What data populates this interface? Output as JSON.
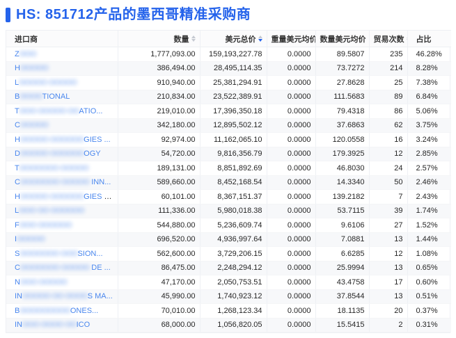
{
  "title": {
    "text": "HS: 851712产品的墨西哥精准采购商"
  },
  "colors": {
    "accent": "#2563eb",
    "link": "#4a87ee",
    "zebra": "#f7f8fa"
  },
  "table": {
    "columns": [
      {
        "label": "进口商",
        "align": "left",
        "sortable": false,
        "sort": null
      },
      {
        "label": "数量",
        "align": "right",
        "sortable": true,
        "sort": "none"
      },
      {
        "label": "美元总价",
        "align": "right",
        "sortable": true,
        "sort": "desc"
      },
      {
        "label": "重量美元均价",
        "align": "right",
        "sortable": false,
        "sort": null
      },
      {
        "label": "数量美元均价",
        "align": "right",
        "sortable": false,
        "sort": null
      },
      {
        "label": "贸易次数",
        "align": "right",
        "sortable": true,
        "sort": "none"
      },
      {
        "label": "占比",
        "align": "left",
        "sortable": false,
        "sort": null
      }
    ],
    "rows": [
      {
        "importer_parts": [
          {
            "text": "Z",
            "redacted": false
          },
          {
            "text": "OOO",
            "redacted": true
          }
        ],
        "quantity": "1,777,093.00",
        "usd_total": "159,193,227.78",
        "weight_unit_price": "0.0000",
        "qty_unit_price": "89.5807",
        "trade_count": "235",
        "share": "46.28%"
      },
      {
        "importer_parts": [
          {
            "text": "H",
            "redacted": false
          },
          {
            "text": "OOOOO",
            "redacted": true
          }
        ],
        "quantity": "386,494.00",
        "usd_total": "28,495,114.35",
        "weight_unit_price": "0.0000",
        "qty_unit_price": "73.7272",
        "trade_count": "214",
        "share": "8.28%"
      },
      {
        "importer_parts": [
          {
            "text": "L",
            "redacted": false
          },
          {
            "text": "OOOOO OOOOO",
            "redacted": true
          }
        ],
        "quantity": "910,940.00",
        "usd_total": "25,381,294.91",
        "weight_unit_price": "0.0000",
        "qty_unit_price": "27.8628",
        "trade_count": "25",
        "share": "7.38%"
      },
      {
        "importer_parts": [
          {
            "text": "B",
            "redacted": false
          },
          {
            "text": "OOOO",
            "redacted": true
          },
          {
            "text": "TIONAL",
            "redacted": false
          }
        ],
        "quantity": "210,834.00",
        "usd_total": "23,522,389.91",
        "weight_unit_price": "0.0000",
        "qty_unit_price": "111.5683",
        "trade_count": "89",
        "share": "6.84%"
      },
      {
        "importer_parts": [
          {
            "text": "T",
            "redacted": false
          },
          {
            "text": "OOO OOOOO OO",
            "redacted": true
          },
          {
            "text": "ATIO...",
            "redacted": false
          }
        ],
        "quantity": "219,010.00",
        "usd_total": "17,396,350.18",
        "weight_unit_price": "0.0000",
        "qty_unit_price": "79.4318",
        "trade_count": "86",
        "share": "5.06%"
      },
      {
        "importer_parts": [
          {
            "text": "C",
            "redacted": false
          },
          {
            "text": "OOOOO",
            "redacted": true
          }
        ],
        "quantity": "342,180.00",
        "usd_total": "12,895,502.12",
        "weight_unit_price": "0.0000",
        "qty_unit_price": "37.6863",
        "trade_count": "62",
        "share": "3.75%"
      },
      {
        "importer_parts": [
          {
            "text": "H",
            "redacted": false
          },
          {
            "text": "OOOOO OOOOOO",
            "redacted": true
          },
          {
            "text": "GIES ...",
            "redacted": false
          }
        ],
        "quantity": "92,974.00",
        "usd_total": "11,162,065.10",
        "weight_unit_price": "0.0000",
        "qty_unit_price": "120.0558",
        "trade_count": "16",
        "share": "3.24%"
      },
      {
        "importer_parts": [
          {
            "text": "D",
            "redacted": false
          },
          {
            "text": "OOOOO OOOOOO",
            "redacted": true
          },
          {
            "text": "OGY",
            "redacted": false
          }
        ],
        "quantity": "54,720.00",
        "usd_total": "9,816,356.79",
        "weight_unit_price": "0.0000",
        "qty_unit_price": "179.3925",
        "trade_count": "12",
        "share": "2.85%"
      },
      {
        "importer_parts": [
          {
            "text": "T",
            "redacted": false
          },
          {
            "text": "OOOOOOO OOOOO",
            "redacted": true
          }
        ],
        "quantity": "189,131.00",
        "usd_total": "8,851,892.69",
        "weight_unit_price": "0.0000",
        "qty_unit_price": "46.8030",
        "trade_count": "24",
        "share": "2.57%"
      },
      {
        "importer_parts": [
          {
            "text": "C",
            "redacted": false
          },
          {
            "text": "OOOOOOO OOOOO",
            "redacted": true
          },
          {
            "text": " INN...",
            "redacted": false
          }
        ],
        "quantity": "589,660.00",
        "usd_total": "8,452,168.54",
        "weight_unit_price": "0.0000",
        "qty_unit_price": "14.3340",
        "trade_count": "50",
        "share": "2.46%"
      },
      {
        "importer_parts": [
          {
            "text": "H",
            "redacted": false
          },
          {
            "text": "OOOOO OOOOOO",
            "redacted": true
          },
          {
            "text": "GIES D...",
            "redacted": false
          }
        ],
        "quantity": "60,101.00",
        "usd_total": "8,367,151.37",
        "weight_unit_price": "0.0000",
        "qty_unit_price": "139.2182",
        "trade_count": "7",
        "share": "2.43%"
      },
      {
        "importer_parts": [
          {
            "text": "L",
            "redacted": false
          },
          {
            "text": "OOO OO OOOOOO",
            "redacted": true
          }
        ],
        "quantity": "111,336.00",
        "usd_total": "5,980,018.38",
        "weight_unit_price": "0.0000",
        "qty_unit_price": "53.7115",
        "trade_count": "39",
        "share": "1.74%"
      },
      {
        "importer_parts": [
          {
            "text": "F",
            "redacted": false
          },
          {
            "text": "OOO OOOOOO",
            "redacted": true
          }
        ],
        "quantity": "544,880.00",
        "usd_total": "5,236,609.74",
        "weight_unit_price": "0.0000",
        "qty_unit_price": "9.6106",
        "trade_count": "27",
        "share": "1.52%"
      },
      {
        "importer_parts": [
          {
            "text": "I",
            "redacted": false
          },
          {
            "text": "OOOOO",
            "redacted": true
          }
        ],
        "quantity": "696,520.00",
        "usd_total": "4,936,997.64",
        "weight_unit_price": "0.0000",
        "qty_unit_price": "7.0881",
        "trade_count": "13",
        "share": "1.44%"
      },
      {
        "importer_parts": [
          {
            "text": "S",
            "redacted": false
          },
          {
            "text": "OOOOOOO OOO",
            "redacted": true
          },
          {
            "text": "SION...",
            "redacted": false
          }
        ],
        "quantity": "562,600.00",
        "usd_total": "3,729,206.15",
        "weight_unit_price": "0.0000",
        "qty_unit_price": "6.6285",
        "trade_count": "12",
        "share": "1.08%"
      },
      {
        "importer_parts": [
          {
            "text": "C",
            "redacted": false
          },
          {
            "text": "OOOOOOO OOOOO",
            "redacted": true
          },
          {
            "text": " DE ...",
            "redacted": false
          }
        ],
        "quantity": "86,475.00",
        "usd_total": "2,248,294.12",
        "weight_unit_price": "0.0000",
        "qty_unit_price": "25.9994",
        "trade_count": "13",
        "share": "0.65%"
      },
      {
        "importer_parts": [
          {
            "text": "N",
            "redacted": false
          },
          {
            "text": "OOO OOOOO",
            "redacted": true
          }
        ],
        "quantity": "47,170.00",
        "usd_total": "2,050,753.51",
        "weight_unit_price": "0.0000",
        "qty_unit_price": "43.4758",
        "trade_count": "17",
        "share": "0.60%"
      },
      {
        "importer_parts": [
          {
            "text": "IN",
            "redacted": false
          },
          {
            "text": "OOOOO OO OOOO",
            "redacted": true
          },
          {
            "text": "S MA...",
            "redacted": false
          }
        ],
        "quantity": "45,990.00",
        "usd_total": "1,740,923.12",
        "weight_unit_price": "0.0000",
        "qty_unit_price": "37.8544",
        "trade_count": "13",
        "share": "0.51%"
      },
      {
        "importer_parts": [
          {
            "text": "B",
            "redacted": false
          },
          {
            "text": "OOOOOOOOO",
            "redacted": true
          },
          {
            "text": "ONES...",
            "redacted": false
          }
        ],
        "quantity": "70,010.00",
        "usd_total": "1,268,123.34",
        "weight_unit_price": "0.0000",
        "qty_unit_price": "18.1135",
        "trade_count": "20",
        "share": "0.37%"
      },
      {
        "importer_parts": [
          {
            "text": "IN",
            "redacted": false
          },
          {
            "text": "OOO OOOO OO",
            "redacted": true
          },
          {
            "text": "ICO",
            "redacted": false
          }
        ],
        "quantity": "68,000.00",
        "usd_total": "1,056,820.05",
        "weight_unit_price": "0.0000",
        "qty_unit_price": "15.5415",
        "trade_count": "2",
        "share": "0.31%"
      }
    ]
  }
}
